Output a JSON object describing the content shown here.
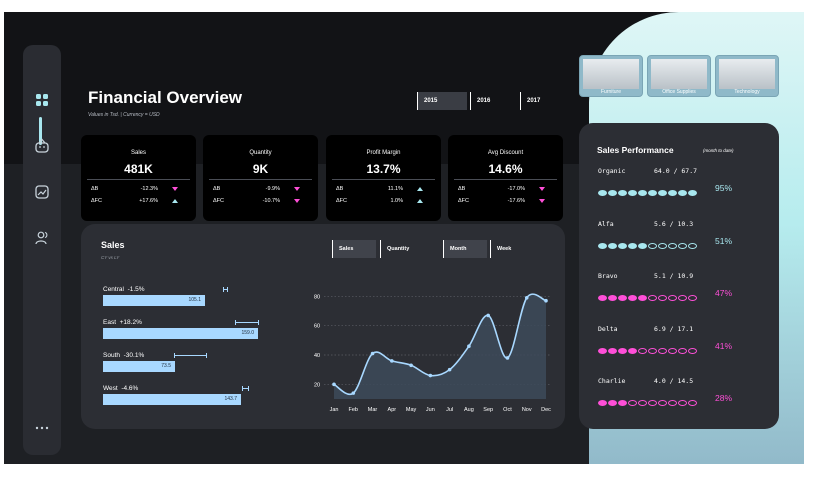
{
  "header": {
    "title": "Financial Overview",
    "subtitle": "Values in Tsd. | Currency = USD",
    "years": [
      "2015",
      "2016",
      "2017"
    ],
    "selected_year": "2015"
  },
  "sidebar": {
    "icons": [
      "grid-icon",
      "inbox-icon",
      "chart-image-icon",
      "users-icon",
      "more-icon"
    ]
  },
  "kpis": [
    {
      "label": "Sales",
      "value": "481K",
      "rows": [
        {
          "label": "ΔB",
          "value": "-12.3%",
          "dir": "down"
        },
        {
          "label": "ΔFC",
          "value": "+17.6%",
          "dir": "up"
        }
      ]
    },
    {
      "label": "Quantity",
      "value": "9K",
      "rows": [
        {
          "label": "ΔB",
          "value": "-9.9%",
          "dir": "down"
        },
        {
          "label": "ΔFC",
          "value": "-10.7%",
          "dir": "down"
        }
      ]
    },
    {
      "label": "Profit Margin",
      "value": "13.7%",
      "rows": [
        {
          "label": "ΔB",
          "value": "11.1%",
          "dir": "up"
        },
        {
          "label": "ΔFC",
          "value": "1.0%",
          "dir": "up"
        }
      ]
    },
    {
      "label": "Avg Discount",
      "value": "14.6%",
      "rows": [
        {
          "label": "ΔB",
          "value": "-17.0%",
          "dir": "down"
        },
        {
          "label": "ΔFC",
          "value": "-17.6%",
          "dir": "down"
        }
      ]
    }
  ],
  "sales_panel": {
    "title": "Sales",
    "subtitle": "CY vs LY",
    "toggles_metric": [
      "Sales",
      "Quantity"
    ],
    "toggles_period": [
      "Month",
      "Week"
    ],
    "regions": [
      {
        "name": "Central",
        "delta": "-1.5%",
        "value": 105.1,
        "label": "105.1"
      },
      {
        "name": "East",
        "delta": "+18.2%",
        "value": 159.0,
        "label": "159.0"
      },
      {
        "name": "South",
        "delta": "-30.1%",
        "value": 73.5,
        "label": "73.5"
      },
      {
        "name": "West",
        "delta": "-4.6%",
        "value": 143.7,
        "label": "143.7"
      }
    ]
  },
  "chart_data": {
    "type": "area",
    "x": [
      "Jan",
      "Feb",
      "Mar",
      "Apr",
      "May",
      "Jun",
      "Jul",
      "Aug",
      "Sep",
      "Oct",
      "Nov",
      "Dec"
    ],
    "y": [
      20,
      14,
      41,
      36,
      33,
      26,
      30,
      46,
      67,
      38,
      79,
      77
    ],
    "yticks": [
      20,
      40,
      60,
      80
    ],
    "ylim": [
      10,
      85
    ],
    "grid": true
  },
  "categories": [
    "Furniture",
    "Office Supplies",
    "Technology"
  ],
  "performance": {
    "title": "Sales Performance",
    "note": "(month to date)",
    "rows": [
      {
        "name": "Organic",
        "ratio": "64.0 / 67.7",
        "pct": "95%",
        "fraction": 0.95,
        "color": "#a8e7ef"
      },
      {
        "name": "Alfa",
        "ratio": "5.6 / 10.3",
        "pct": "51%",
        "fraction": 0.51,
        "color": "#a8e7ef"
      },
      {
        "name": "Bravo",
        "ratio": "5.1 / 10.9",
        "pct": "47%",
        "fraction": 0.47,
        "color": "#ff4fd8"
      },
      {
        "name": "Delta",
        "ratio": "6.9 / 17.1",
        "pct": "41%",
        "fraction": 0.41,
        "color": "#ff4fd8"
      },
      {
        "name": "Charlie",
        "ratio": "4.0 / 14.5",
        "pct": "28%",
        "fraction": 0.28,
        "color": "#ff4fd8"
      }
    ]
  }
}
